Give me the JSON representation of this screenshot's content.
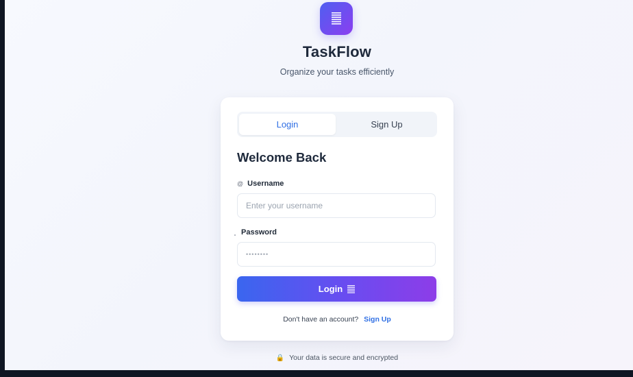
{
  "app": {
    "name": "TaskFlow",
    "tagline": "Organize your tasks efficiently",
    "logo_icon": "document-lines-icon",
    "brand_gradient": [
      "#4f5ff0",
      "#8b3ef0"
    ]
  },
  "tabs": [
    {
      "label": "Login",
      "active": true
    },
    {
      "label": "Sign Up",
      "active": false
    }
  ],
  "form": {
    "heading": "Welcome Back",
    "username": {
      "label": "Username",
      "icon": "at-sign-icon",
      "icon_glyph": "@",
      "placeholder": "Enter your username",
      "value": ""
    },
    "password": {
      "label": "Password",
      "placeholder": "••••••••",
      "value": ""
    },
    "submit_label": "Login",
    "submit_icon": "document-lines-icon"
  },
  "footer": {
    "prompt": "Don't have an account?",
    "link": "Sign Up"
  },
  "security_note": {
    "icon": "lock-icon",
    "icon_glyph": "🔒",
    "text": "Your data is secure and encrypted"
  },
  "colors": {
    "accent": "#2f6fe4",
    "button_start": "#3a66ef",
    "button_end": "#8d3de8"
  }
}
